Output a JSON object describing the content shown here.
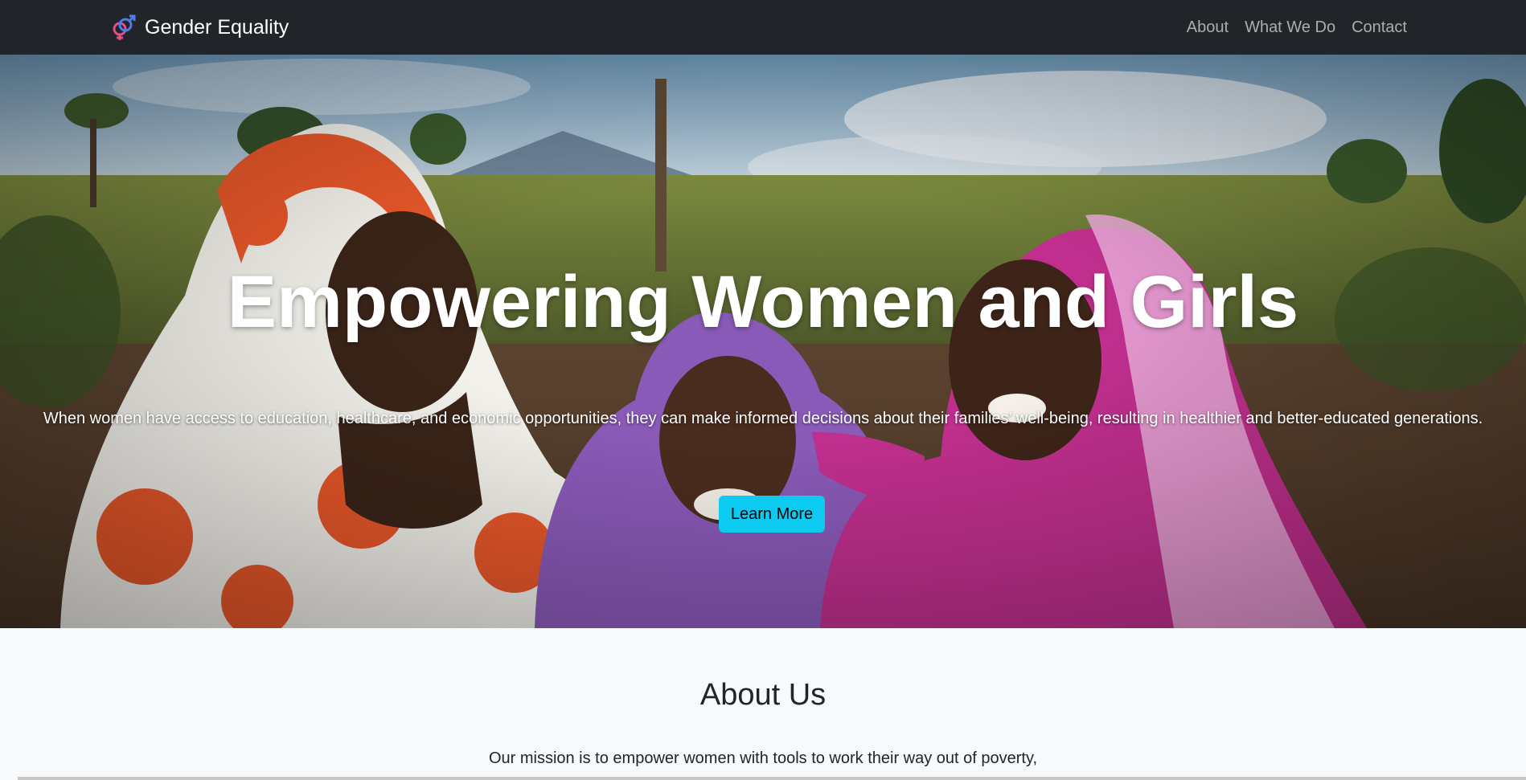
{
  "navbar": {
    "brand_label": "Gender Equality",
    "brand_icon": "gender-symbol-icon",
    "links": [
      {
        "label": "About"
      },
      {
        "label": "What We Do"
      },
      {
        "label": "Contact"
      }
    ]
  },
  "hero": {
    "title": "Empowering Women and Girls",
    "text": "When women have access to education, healthcare, and economic opportunities, they can make informed decisions about their families’ well-being, resulting in healthier and better-educated generations.",
    "button_label": "Learn More"
  },
  "about": {
    "title": "About Us",
    "text": "Our mission is to empower women with tools to work their way out of poverty,"
  },
  "colors": {
    "navbar_bg": "#212529",
    "accent_button": "#0dcaf0",
    "section_bg": "#f8f9fa"
  }
}
